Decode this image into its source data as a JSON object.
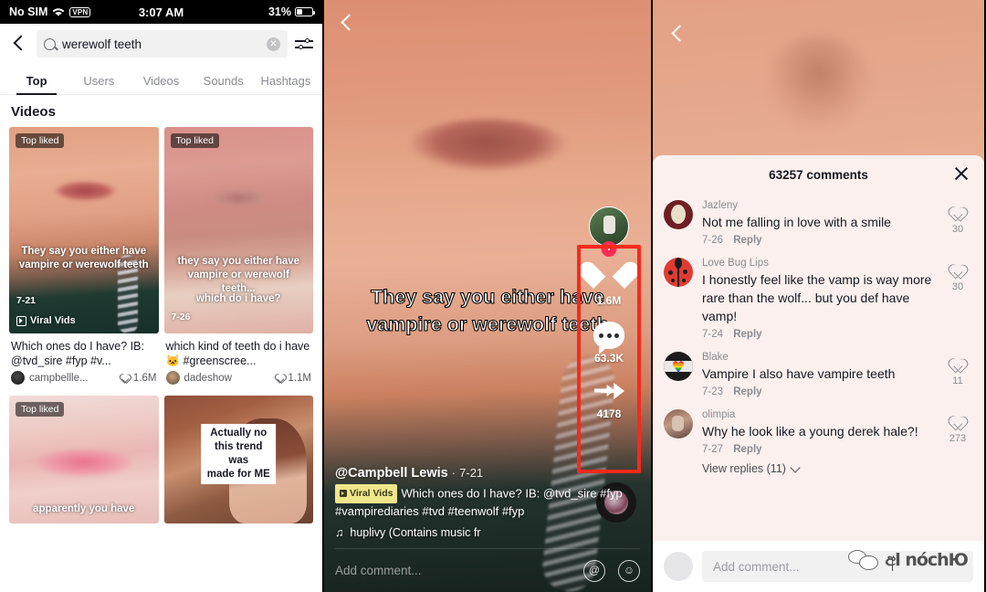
{
  "status_bar": {
    "carrier": "No SIM",
    "wifi_icon": "wifi-icon",
    "vpn": "VPN",
    "time": "3:07 AM",
    "battery_pct": "31%"
  },
  "search": {
    "back_icon": "back-chevron-icon",
    "search_icon": "search-icon",
    "query": "werewolf teeth",
    "clear_icon": "clear-circle-icon",
    "filter_icon": "filter-sliders-icon",
    "tabs": [
      {
        "label": "Top",
        "active": true
      },
      {
        "label": "Users",
        "active": false
      },
      {
        "label": "Videos",
        "active": false
      },
      {
        "label": "Sounds",
        "active": false
      },
      {
        "label": "Hashtags",
        "active": false
      }
    ],
    "section_title": "Videos",
    "results": [
      {
        "badge": "Top liked",
        "overlay_text": "They say you either have\nvampire or werewolf teeth",
        "date": "7-21",
        "source": "Viral Vids",
        "caption": "Which ones do I have? IB: @tvd_sire #fyp #v...",
        "author": "campbellle...",
        "likes": "1.6M"
      },
      {
        "badge": "Top liked",
        "overlay_text": "they say you either have\nvampire or werewolf teeth...",
        "overlay_text2": "which do i have?",
        "date": "7-26",
        "source": "",
        "caption": "which kind of teeth do i have 🐱 #greenscree...",
        "author": "dadeshow",
        "likes": "1.1M"
      },
      {
        "badge": "Top liked",
        "overlay_text": "apparently you have",
        "date": "",
        "source": "",
        "caption": "",
        "author": "",
        "likes": ""
      },
      {
        "badge": "",
        "overlay_text": "Actually no this trend was\nmade for ME",
        "date": "",
        "source": "",
        "caption": "",
        "author": "",
        "likes": ""
      }
    ]
  },
  "video": {
    "back_icon": "back-chevron-icon",
    "overlay_text": "They say you either have vampire or werewolf teeth",
    "author_avatar": "creator-avatar",
    "follow_icon": "plus-follow-icon",
    "like_icon": "heart-icon",
    "like_count": "1.6M",
    "comment_icon": "comment-bubble-icon",
    "comment_count": "63.3K",
    "share_icon": "share-arrow-icon",
    "share_count": "4178",
    "username": "@Campbell Lewis",
    "separator": "·",
    "post_date": "7-21",
    "tag_label": "Viral Vids",
    "description": "Which ones do I have? IB: @tvd_sire #fyp #vampirediaries #tvd #teenwolf #fyp",
    "music_icon": "music-note-icon",
    "music_text": "huplivy (Contains music fr",
    "disc_icon": "record-disc-icon",
    "comment_placeholder": "Add comment...",
    "mention_icon": "at-mention-icon",
    "emoji_icon": "emoji-smiley-icon"
  },
  "comments_panel": {
    "back_icon": "back-chevron-icon",
    "header_title": "63257 comments",
    "close_icon": "close-x-icon",
    "comments": [
      {
        "name": "Jazleny",
        "text": "Not me falling in love with a smile",
        "date": "7-26",
        "reply": "Reply",
        "likes": "30",
        "avatar": "face-avatar",
        "avatar_color": "#6e1f24"
      },
      {
        "name": "Love Bug Lips",
        "text": "I honestly feel like the vamp is way more rare than the wolf... but you def have vamp!",
        "date": "7-24",
        "reply": "Reply",
        "likes": "30",
        "avatar": "ladybug-avatar",
        "avatar_color": "#e03b32"
      },
      {
        "name": "Blake",
        "text": "Vampire I also have vampire teeth",
        "date": "7-23",
        "reply": "Reply",
        "likes": "11",
        "avatar": "rainbow-heart-avatar",
        "avatar_color": "#1c1c1c"
      },
      {
        "name": "olimpia",
        "text": "Why he look like a young derek hale?!",
        "date": "7-27",
        "reply": "Reply",
        "likes": "273",
        "avatar": "photo-avatar",
        "avatar_color": "#7a5548",
        "view_replies": "View replies (11)"
      }
    ],
    "input_placeholder": "Add comment...",
    "watermark_text": "අl nóchЮ",
    "watermark_icon": "wechat-bubbles-icon"
  },
  "colors": {
    "accent": "#fe2c55",
    "annotation_box": "#f52a1d",
    "text_primary": "#161823",
    "text_muted": "#8a8b91"
  }
}
